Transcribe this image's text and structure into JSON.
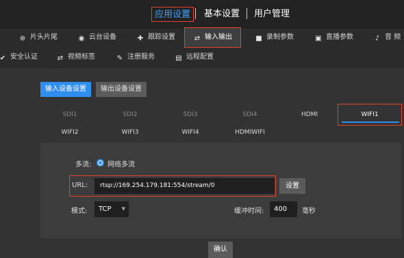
{
  "top_tabs": [
    "应用设置",
    "基本设置",
    "用户管理"
  ],
  "sub_nav": [
    {
      "label": "片头片尾",
      "icon": "film-reel-icon",
      "glyph": "⊛"
    },
    {
      "label": "云台设备",
      "icon": "camera-ptz-icon",
      "glyph": "◉"
    },
    {
      "label": "跟踪设置",
      "icon": "tracking-target-icon",
      "glyph": "✚"
    },
    {
      "label": "输入输出",
      "icon": "transfer-arrows-icon",
      "glyph": "⇄"
    },
    {
      "label": "录制参数",
      "icon": "video-record-icon",
      "glyph": "■"
    },
    {
      "label": "直播参数",
      "icon": "broadcast-icon",
      "glyph": "▣"
    },
    {
      "label": "音 频",
      "icon": "microphone-icon",
      "glyph": "♪"
    },
    {
      "label": "安全认证",
      "icon": "shield-check-icon",
      "glyph": "✔"
    },
    {
      "label": "视频标签",
      "icon": "video-tag-icon",
      "glyph": "⇄"
    },
    {
      "label": "注册服务",
      "icon": "register-edit-icon",
      "glyph": "✎"
    },
    {
      "label": "远程配置",
      "icon": "remote-config-icon",
      "glyph": "▤"
    }
  ],
  "io_buttons": {
    "input": "输入设备设置",
    "output": "输出设备设置"
  },
  "source_tabs": [
    "SDI1",
    "SDI2",
    "SDI3",
    "SDI4",
    "HDMI",
    "WIFI1",
    "WIFI2",
    "WIFI3",
    "WIFI4",
    "HDMIWIFI"
  ],
  "form": {
    "multistream_label": "多流:",
    "multistream_option": "网络多流",
    "url_label": "URL:",
    "url_value": "rtsp://169.254.179.181:554/stream/0",
    "set_button": "设置",
    "mode_label": "模式:",
    "mode_value": "TCP",
    "buffer_label": "缓冲时间:",
    "buffer_value": "400",
    "buffer_unit": "毫秒"
  },
  "confirm_button": "确认",
  "colors": {
    "accent": "#2f8ff0",
    "highlight_border": "#e8412c",
    "background": "#333333"
  }
}
